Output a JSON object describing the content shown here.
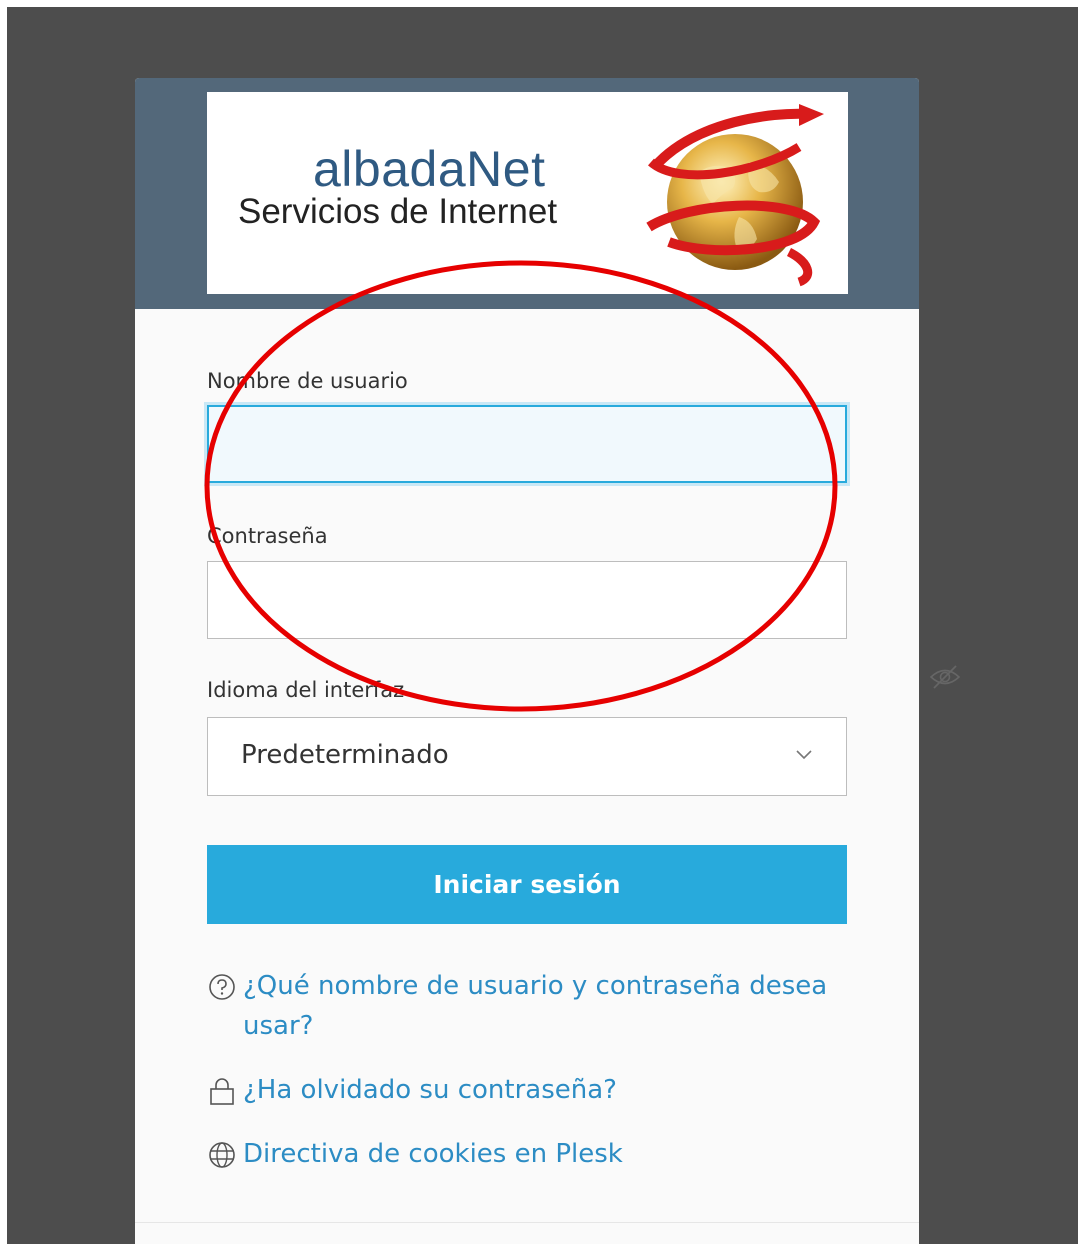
{
  "logo": {
    "name": "albadaNet",
    "tagline": "Servicios de Internet"
  },
  "form": {
    "username_label": "Nombre de usuario",
    "username_value": "",
    "password_label": "Contraseña",
    "password_value": "",
    "language_label": "Idioma del interfaz",
    "language_selected": "Predeterminado",
    "submit_label": "Iniciar sesión"
  },
  "links": {
    "help": "¿Qué nombre de usuario y contraseña desea usar?",
    "forgot_password": "¿Ha olvidado su contraseña?",
    "cookies": "Directiva de cookies en Plesk"
  },
  "icons": [
    "eye-slash-icon",
    "chevron-down-icon",
    "question-circle-icon",
    "lock-icon",
    "globe-icon"
  ],
  "colors": {
    "header": "#53687a",
    "accent": "#28aadc",
    "link": "#2c8cc4",
    "annotation": "#e60000"
  }
}
